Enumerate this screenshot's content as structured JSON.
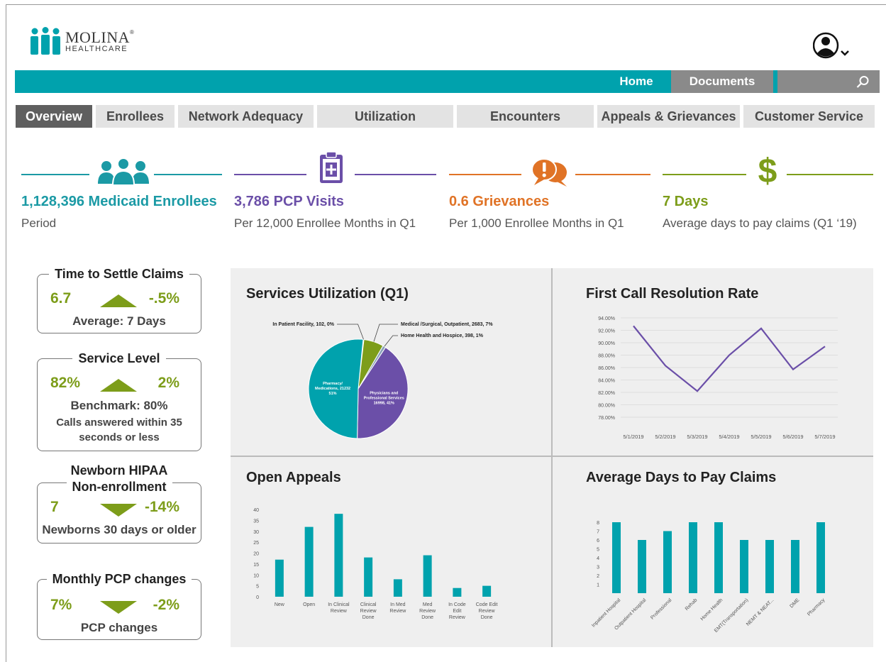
{
  "brand": {
    "name": "MOLINA",
    "sub": "HEALTHCARE",
    "reg": "®",
    "color": "#00a2ad"
  },
  "nav": {
    "home": "Home",
    "documents": "Documents",
    "search_icon": "search-icon"
  },
  "tabs": [
    "Overview",
    "Enrollees",
    "Network Adequacy",
    "Utilization",
    "Encounters",
    "Appeals & Grievances",
    "Customer Service"
  ],
  "kpis": [
    {
      "value": "1,128,396 Medicaid Enrollees",
      "sub": "Period",
      "color": "#1b9aa5",
      "icon": "people-icon"
    },
    {
      "value": "3,786 PCP Visits",
      "sub": "Per 12,000 Enrollee Months in Q1",
      "color": "#6b4fa8",
      "icon": "clipboard-icon"
    },
    {
      "value": "0.6 Grievances",
      "sub": "Per 1,000 Enrollee Months in Q1",
      "color": "#e07326",
      "icon": "speech-alert-icon"
    },
    {
      "value": "7 Days",
      "sub": "Average days to pay claims (Q1 ‘19)",
      "color": "#7d9d1a",
      "icon": "dollar-icon"
    }
  ],
  "metrics": [
    {
      "title": "Time to Settle Claims",
      "left": "6.7",
      "right": "-.5%",
      "trend": "up",
      "desc": "Average: 7 Days"
    },
    {
      "title": "Service Level",
      "left": "82%",
      "right": "2%",
      "trend": "up",
      "desc": "Benchmark: 80%",
      "desc2a": "Calls answered within 35",
      "desc2b": "seconds or less"
    },
    {
      "title": "Newborn HIPAA",
      "title2": "Non-enrollment",
      "left": "7",
      "right": "-14%",
      "trend": "down",
      "desc": "Newborns 30 days or older"
    },
    {
      "title": "Monthly PCP changes",
      "left": "7%",
      "right": "-2%",
      "trend": "down",
      "desc": "PCP changes"
    }
  ],
  "panels": {
    "services": "Services Utilization (Q1)",
    "fcr": "First Call Resolution Rate",
    "appeals": "Open Appeals",
    "days": "Average Days to Pay Claims"
  },
  "chart_data": [
    {
      "type": "pie",
      "title": "Services Utilization (Q1)",
      "slices": [
        {
          "label": "In Patient Facility, 102, 0%",
          "value": 102,
          "color": "#00a2ad"
        },
        {
          "label": "Medical /Surgical, Outpatient, 2683, 7%",
          "value": 2683,
          "color": "#7d9d1a"
        },
        {
          "label": "Home Health and Hospice, 398, 1%",
          "value": 398,
          "color": "#8aa2b8"
        },
        {
          "label": "Physicians and Professional Services 16998, 41%",
          "value": 16998,
          "color": "#6b4fa8"
        },
        {
          "label": "Pharmacy/ Medications, 21232 51%",
          "value": 21232,
          "color": "#00a2ad"
        }
      ]
    },
    {
      "type": "line",
      "title": "First Call Resolution Rate",
      "x": [
        "5/1/2019",
        "5/2/2019",
        "5/3/2019",
        "5/4/2019",
        "5/5/2019",
        "5/6/2019",
        "5/7/2019"
      ],
      "values": [
        92.7,
        86.3,
        82.2,
        88.0,
        92.3,
        85.7,
        89.4
      ],
      "yticks": [
        "94.00%",
        "92.00%",
        "90.00%",
        "88.00%",
        "86.00%",
        "84.00%",
        "82.00%",
        "80.00%",
        "78.00%"
      ],
      "ylim": [
        78,
        94
      ],
      "color": "#6b4fa8"
    },
    {
      "type": "bar",
      "title": "Open Appeals",
      "categories": [
        [
          "New"
        ],
        [
          "Open"
        ],
        [
          "In Clinical",
          "Review"
        ],
        [
          "Clinical",
          "Review",
          "Done"
        ],
        [
          "In Med",
          "Review"
        ],
        [
          "Med",
          "Review",
          "Done"
        ],
        [
          "In Code",
          "Edit",
          "Review"
        ],
        [
          "Code Edit",
          "Review",
          "Done"
        ]
      ],
      "values": [
        17,
        32,
        38,
        18,
        8,
        19,
        4,
        5
      ],
      "yticks": [
        "40",
        "35",
        "30",
        "25",
        "20",
        "15",
        "10",
        "5",
        "0"
      ],
      "ylim": [
        0,
        40
      ],
      "color": "#00a2ad"
    },
    {
      "type": "bar",
      "title": "Average Days to Pay Claims",
      "categories": [
        "Inpatient Hospital",
        "Outpatient Hospital",
        "Professional",
        "Rehab",
        "Home Health",
        "EMT(Transportation)",
        "NEMT & NEAT...",
        "DME",
        "Pharmacy"
      ],
      "values": [
        8,
        6,
        7,
        8,
        8,
        6,
        6,
        6,
        8
      ],
      "yticks": [
        "8",
        "7",
        "6",
        "5",
        "4",
        "3",
        "2",
        "1"
      ],
      "ylim": [
        0,
        8
      ],
      "color": "#00a2ad"
    }
  ]
}
